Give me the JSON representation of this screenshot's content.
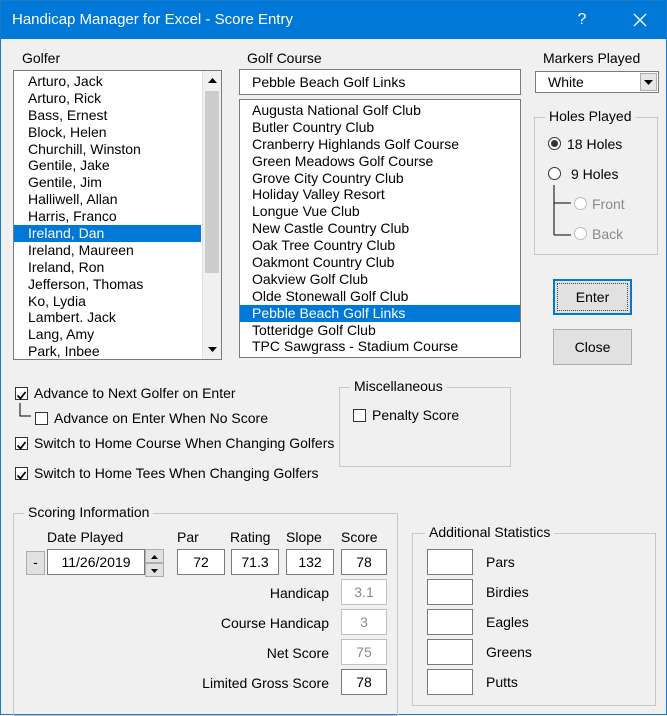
{
  "window": {
    "title": "Handicap Manager for Excel - Score Entry",
    "help": "?"
  },
  "golfer": {
    "label": "Golfer",
    "items": [
      "Arturo, Jack",
      "Arturo, Rick",
      "Bass, Ernest",
      "Block, Helen",
      "Churchill, Winston",
      "Gentile, Jake",
      "Gentile, Jim",
      "Halliwell, Allan",
      "Harris, Franco",
      "Ireland, Dan",
      "Ireland, Maureen",
      "Ireland, Ron",
      "Jefferson, Thomas",
      "Ko, Lydia",
      "Lambert. Jack",
      "Lang, Amy",
      "Park, Inbee"
    ],
    "selected": "Ireland, Dan"
  },
  "course": {
    "label": "Golf Course",
    "current": "Pebble Beach Golf Links",
    "items": [
      "Augusta National Golf Club",
      "Butler Country Club",
      "Cranberry Highlands Golf Course",
      "Green Meadows Golf Course",
      "Grove City Country Club",
      "Holiday Valley Resort",
      "Longue Vue Club",
      "New Castle Country Club",
      "Oak Tree Country Club",
      "Oakmont Country Club",
      "Oakview Golf Club",
      "Olde Stonewall Golf Club",
      "Pebble Beach Golf Links",
      "Totteridge Golf Club",
      "TPC Sawgrass - Stadium Course"
    ],
    "selected": "Pebble Beach Golf Links"
  },
  "markers": {
    "label": "Markers Played",
    "value": "White"
  },
  "holes": {
    "label": "Holes Played",
    "opt18": "18 Holes",
    "opt9": "9 Holes",
    "front": "Front",
    "back": "Back",
    "selected": "18 Holes"
  },
  "buttons": {
    "enter": "Enter",
    "close": "Close",
    "minus": "-"
  },
  "options": {
    "advance": "Advance to Next Golfer on Enter",
    "advance_no_score": "Advance on Enter When No Score",
    "switch_course": "Switch to Home Course When Changing Golfers",
    "switch_tees": "Switch to Home Tees When Changing Golfers",
    "checked": {
      "advance": true,
      "advance_no_score": false,
      "switch_course": true,
      "switch_tees": true
    }
  },
  "misc": {
    "label": "Miscellaneous",
    "penalty": "Penalty Score",
    "penalty_checked": false
  },
  "scoring": {
    "label": "Scoring Information",
    "date_label": "Date Played",
    "date": "11/26/2019",
    "par_label": "Par",
    "par": "72",
    "rating_label": "Rating",
    "rating": "71.3",
    "slope_label": "Slope",
    "slope": "132",
    "score_label": "Score",
    "score": "78",
    "handicap_label": "Handicap",
    "handicap": "3.1",
    "course_handicap_label": "Course Handicap",
    "course_handicap": "3",
    "net_score_label": "Net Score",
    "net_score": "75",
    "limited_gross_label": "Limited Gross Score",
    "limited_gross": "78"
  },
  "stats": {
    "label": "Additional Statistics",
    "items": [
      {
        "label": "Pars",
        "value": ""
      },
      {
        "label": "Birdies",
        "value": ""
      },
      {
        "label": "Eagles",
        "value": ""
      },
      {
        "label": "Greens",
        "value": ""
      },
      {
        "label": "Putts",
        "value": ""
      }
    ]
  },
  "colors": {
    "titlebar": "#0078d7",
    "selection": "#0078d7",
    "dialog": "#f0f0f0"
  }
}
